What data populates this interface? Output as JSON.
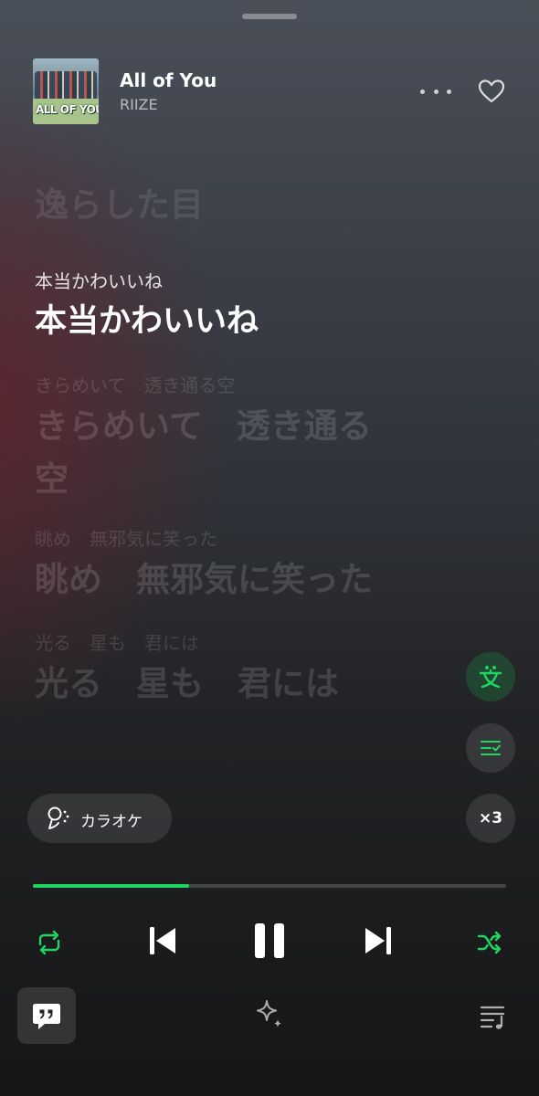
{
  "track": {
    "title": "All of You",
    "artist": "RIIZE",
    "album_logo_text": "ALL OF YOU"
  },
  "lyrics": {
    "prev_line": "逸らした目",
    "active": {
      "reading": "本当かわいいね",
      "text": "本当かわいいね"
    },
    "upcoming": [
      {
        "reading": "きらめいて　透き通る空",
        "text_line1": "きらめいて　透き通る",
        "text_line2": "空"
      },
      {
        "reading": "眺め　無邪気に笑った",
        "text_line1": "眺め　無邪気に笑った"
      },
      {
        "reading": "光る　星も　君には",
        "text_line1": "光る　星も　君には"
      }
    ]
  },
  "controls": {
    "karaoke_label": "カラオケ",
    "speed_label": "×3",
    "progress_fraction": 0.33,
    "accent_color": "#1ed760"
  },
  "icons": {
    "more": "more-dots-icon",
    "like": "heart-icon",
    "translate": "translate-icon",
    "lyrics_list": "lyrics-list-icon",
    "karaoke": "microphone-icon",
    "repeat": "repeat-icon",
    "previous": "previous-track-icon",
    "pause": "pause-icon",
    "next": "next-track-icon",
    "shuffle": "shuffle-icon",
    "chat": "quote-bubble-icon",
    "sparkle": "sparkle-icon",
    "queue": "queue-icon"
  }
}
